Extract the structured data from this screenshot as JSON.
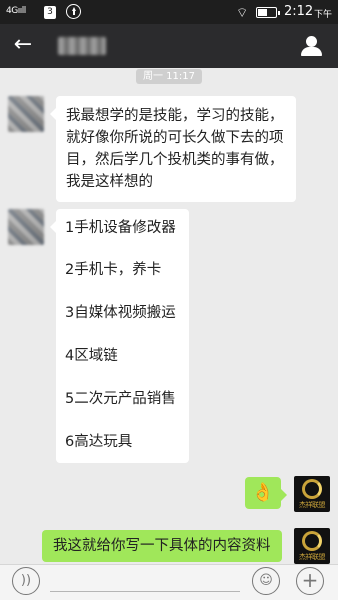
{
  "status_bar": {
    "network": "4G",
    "signal_text": "4Gııll",
    "sim_badge": "3",
    "upload_icon": "upload-circle-icon",
    "wifi_icon": "wifi-icon",
    "battery_icon": "battery-icon",
    "battery_level": 0.45,
    "time": "2:12",
    "ampm": "下午"
  },
  "header": {
    "back_icon": "←",
    "contact_name": "",
    "profile_icon": "person-icon"
  },
  "chat": {
    "timestamp": "周一 11:17",
    "messages": [
      {
        "side": "received",
        "lines": [
          "我最想学的是技能，学习的技能，",
          "就好像你所说的可长久做下去的项",
          "目，然后学几个投机类的事有做，",
          "我是这样想的"
        ]
      },
      {
        "side": "received",
        "lines": [
          "1手机设备修改器",
          "2手机卡，养卡",
          "3自媒体视频搬运",
          "4区域链",
          "5二次元产品销售",
          "6高达玩具"
        ]
      },
      {
        "side": "sent",
        "emoji": "👌"
      },
      {
        "side": "sent",
        "text": "我这就给你写一下具体的内容资料"
      }
    ],
    "brand_avatar_text": "杰祥联盟"
  },
  "input_bar": {
    "voice_icon": "voice-icon",
    "voice_glyph": "))",
    "emoji_icon": "smiley-icon",
    "emoji_glyph": "☺",
    "plus_icon": "plus-icon",
    "plus_glyph": "+"
  }
}
